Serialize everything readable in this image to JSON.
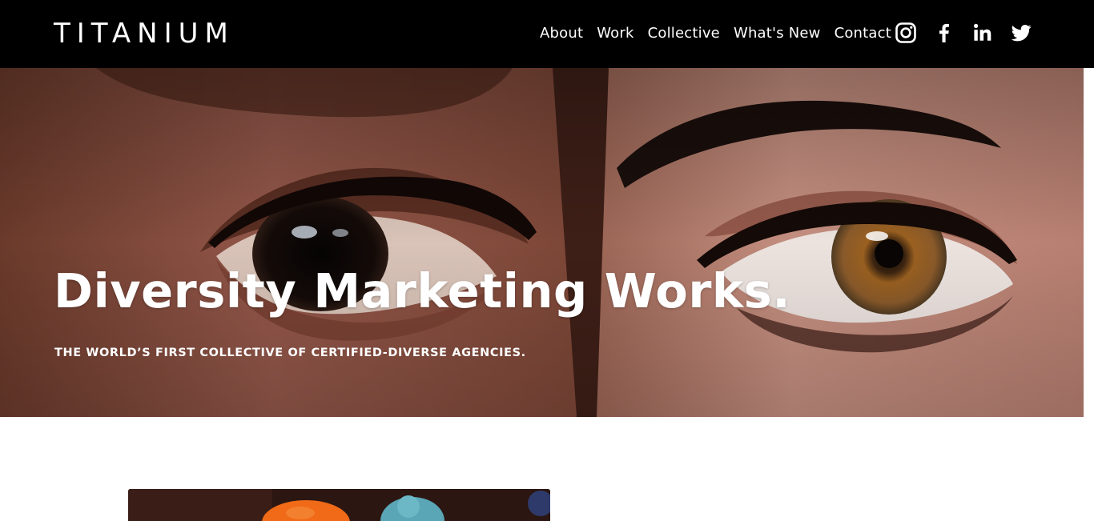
{
  "brand": {
    "logo_text": "TITANIUM"
  },
  "nav": {
    "items": [
      {
        "label": "About"
      },
      {
        "label": "Work"
      },
      {
        "label": "Collective"
      },
      {
        "label": "What's New"
      },
      {
        "label": "Contact"
      }
    ]
  },
  "social": {
    "icons": [
      "instagram-icon",
      "facebook-icon",
      "linkedin-icon",
      "twitter-icon"
    ]
  },
  "hero": {
    "headline": "Diversity Marketing Works.",
    "subheadline": "THE WORLD’S FIRST COLLECTIVE OF CERTIFIED-DIVERSE AGENCIES."
  },
  "colors": {
    "header_bg": "#000000",
    "text": "#ffffff",
    "page_bg": "#ffffff"
  }
}
